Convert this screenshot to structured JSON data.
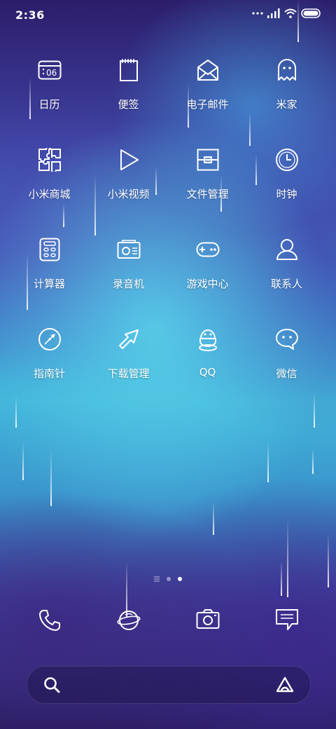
{
  "status_bar": {
    "time": "2:36"
  },
  "apps": [
    {
      "name": "calendar",
      "label": "日历",
      "date": "06"
    },
    {
      "name": "notes",
      "label": "便签"
    },
    {
      "name": "email",
      "label": "电子邮件"
    },
    {
      "name": "mi-home",
      "label": "米家"
    },
    {
      "name": "mi-store",
      "label": "小米商城"
    },
    {
      "name": "mi-video",
      "label": "小米视频"
    },
    {
      "name": "file-manager",
      "label": "文件管理"
    },
    {
      "name": "clock",
      "label": "时钟"
    },
    {
      "name": "calculator",
      "label": "计算器"
    },
    {
      "name": "recorder",
      "label": "录音机"
    },
    {
      "name": "game-center",
      "label": "游戏中心"
    },
    {
      "name": "contacts",
      "label": "联系人"
    },
    {
      "name": "compass",
      "label": "指南针"
    },
    {
      "name": "downloads",
      "label": "下载管理"
    },
    {
      "name": "qq",
      "label": "QQ"
    },
    {
      "name": "wechat",
      "label": "微信"
    }
  ],
  "page_indicator": {
    "current_page": 3
  },
  "dock": [
    "phone",
    "browser",
    "camera",
    "messages"
  ]
}
